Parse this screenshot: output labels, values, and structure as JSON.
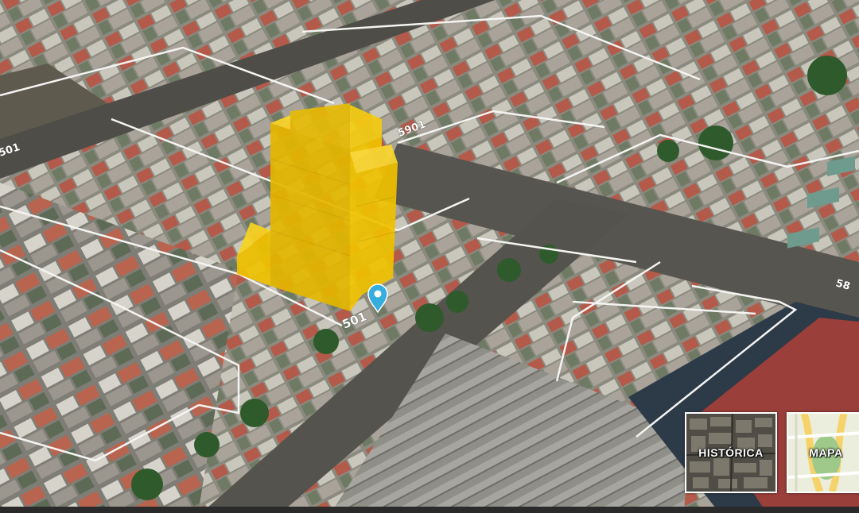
{
  "map": {
    "street_labels": [
      "501",
      "5901",
      "501",
      "58"
    ],
    "building_color": "#f2c400",
    "marker_color": "#35aede"
  },
  "layer_switcher": {
    "historic_label": "HISTÓRICA",
    "map_label": "MAPA"
  }
}
